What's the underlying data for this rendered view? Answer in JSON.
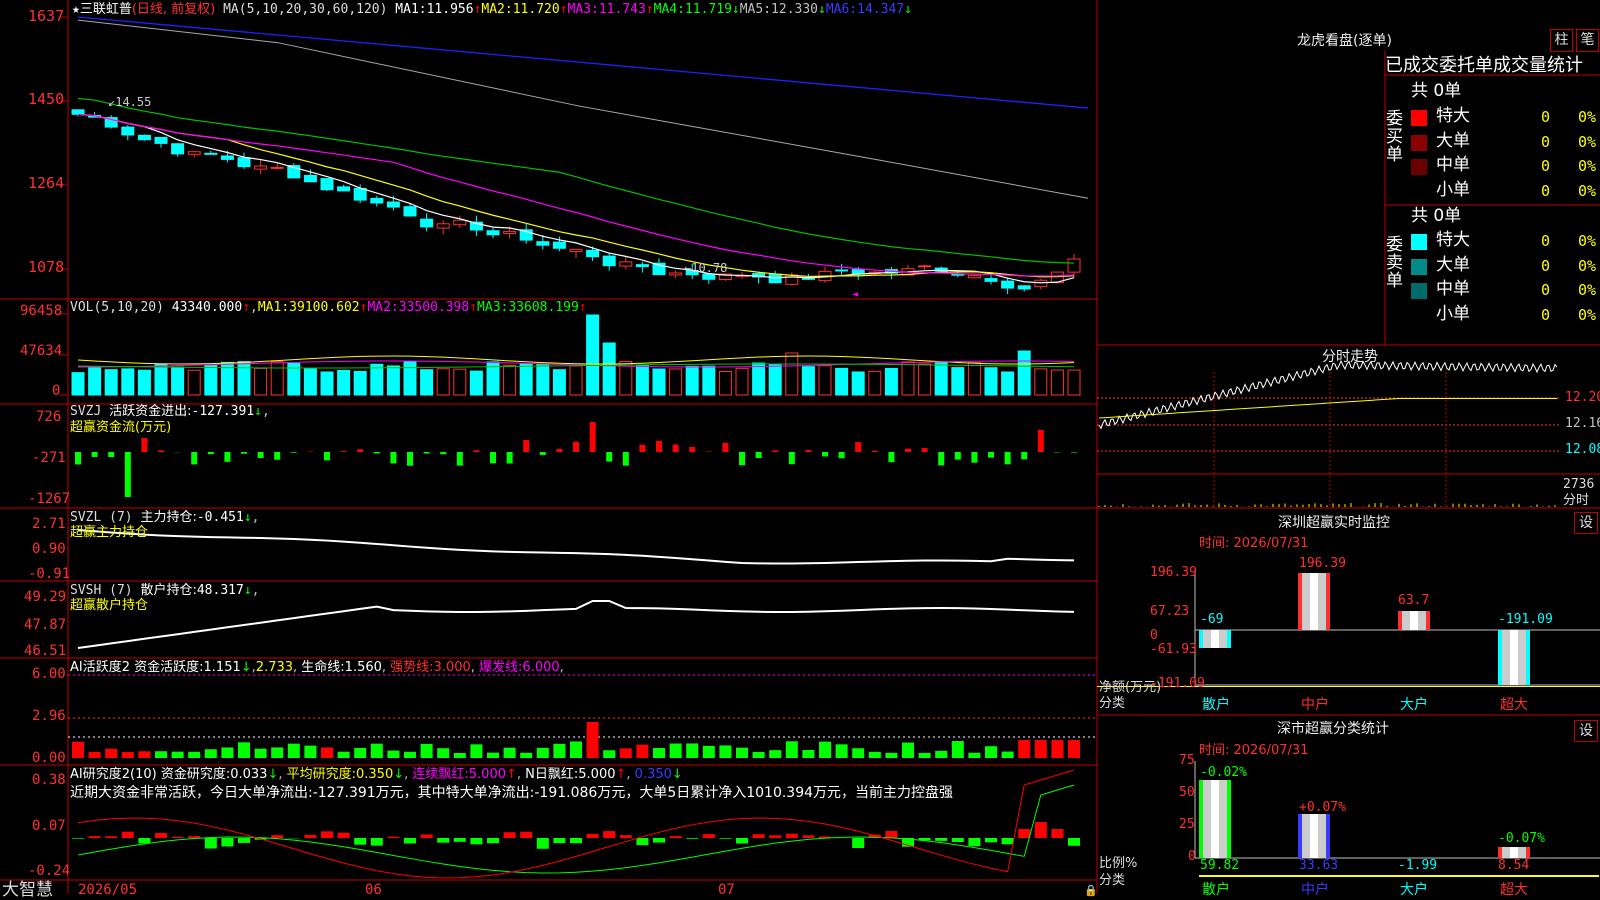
{
  "stock_name": "三联虹普",
  "period_label": "(日线, 前复权)",
  "ma_formula": "MA(5,10,20,30,60,120)",
  "ma": [
    {
      "label": "MA1:",
      "value": "11.956",
      "arrow": "↑",
      "color": "#ffffff"
    },
    {
      "label": "MA2:",
      "value": "11.720",
      "arrow": "↑",
      "color": "#ffff00"
    },
    {
      "label": "MA3:",
      "value": "11.743",
      "arrow": "↑",
      "color": "#ff00ff"
    },
    {
      "label": "MA4:",
      "value": "11.719",
      "arrow": "↓",
      "color": "#00ff00"
    },
    {
      "label": "MA5:",
      "value": "12.330",
      "arrow": "↓",
      "color": "#c0c0c0"
    },
    {
      "label": "MA6:",
      "value": "14.347",
      "arrow": "↓",
      "color": "#3b3bff"
    }
  ],
  "price_axis": [
    "1637",
    "1450",
    "1264",
    "1078"
  ],
  "price_high_label": "14.55",
  "price_low_label": "10.78",
  "vol": {
    "formula": "VOL(5,10,20)",
    "value": "43340.000",
    "arrow": "↑",
    "ma": [
      {
        "label": "MA1:",
        "value": "39100.602",
        "arrow": "↑",
        "color": "#ffff00"
      },
      {
        "label": "MA2:",
        "value": "33500.398",
        "arrow": "↑",
        "color": "#ff00ff"
      },
      {
        "label": "MA3:",
        "value": "33608.199",
        "arrow": "↑",
        "color": "#00ff00"
      }
    ],
    "axis": [
      "96458",
      "47634",
      "0"
    ]
  },
  "svzj": {
    "formula": "SVZJ",
    "label": "活跃资金进出:",
    "value": "-127.391",
    "arrow": "↓",
    "subtitle": "超赢资金流(万元)",
    "axis": [
      "726",
      "-271",
      "-1267"
    ]
  },
  "svzl": {
    "formula": "SVZL (7)",
    "label": "主力持仓:",
    "value": "-0.451",
    "arrow": "↓",
    "subtitle": "超赢主力持仓",
    "axis": [
      "2.71",
      "0.90",
      "-0.91"
    ]
  },
  "svsh": {
    "formula": "SVSH (7)",
    "label": "散户持仓:",
    "value": "48.317",
    "arrow": "↓",
    "subtitle": "超赢散户持仓",
    "axis": [
      "49.29",
      "47.87",
      "46.51"
    ]
  },
  "ai_active": {
    "formula": "AI活跃度2",
    "label": "资金活跃度:",
    "value": "1.151",
    "arrow": "↓",
    "value2": "2.733",
    "life_label": "生命线:",
    "life_value": "1.560",
    "strong_label": "强势线:",
    "strong_value": "3.000",
    "burst_label": "爆发线:",
    "burst_value": "6.000",
    "axis": [
      "6.00",
      "2.96",
      "0.00"
    ]
  },
  "ai_research": {
    "formula": "AI研究度2(10)",
    "label": "资金研究度:",
    "value": "0.033",
    "arrow": "↓",
    "avg_label": "平均研究度:",
    "avg_value": "0.350",
    "avg_arrow": "↓",
    "cont_label": "连续飘红:",
    "cont_value": "5.000",
    "cont_arrow": "↑",
    "n_label": "N日飘红:",
    "n_value": "5.000",
    "n_arrow": "↑",
    "last_value": "0.350",
    "last_arrow": "↓",
    "comment": "近期大资金非常活跃，今日大单净流出:-127.391万元，其中特大单净流出:-191.086万元，大单5日累计净入1010.394万元，当前主力控盘强",
    "axis": [
      "0.38",
      "0.07",
      "-0.24"
    ]
  },
  "date_axis": [
    "2026/05",
    "06",
    "07"
  ],
  "brand": "大智慧",
  "right": {
    "dragon_title": "龙虎看盘(逐单)",
    "btn_bar": "柱",
    "btn_pen": "笔",
    "stat_title": "已成交委托单成交量统计",
    "buy_label": "委买单",
    "sell_label": "委卖单",
    "buy_total": "共 0单",
    "sell_total": "共 0单",
    "buy_rows": [
      {
        "name": "特大",
        "count": "0",
        "pct": "0%",
        "color": "#ff0000"
      },
      {
        "name": "大单",
        "count": "0",
        "pct": "0%",
        "color": "#8b0000"
      },
      {
        "name": "中单",
        "count": "0",
        "pct": "0%",
        "color": "#6b0000"
      },
      {
        "name": "小单",
        "count": "0",
        "pct": "0%",
        "color": ""
      }
    ],
    "sell_rows": [
      {
        "name": "特大",
        "count": "0",
        "pct": "0%",
        "color": "#00ffff"
      },
      {
        "name": "大单",
        "count": "0",
        "pct": "0%",
        "color": "#008b8b"
      },
      {
        "name": "中单",
        "count": "0",
        "pct": "0%",
        "color": "#006b6b"
      },
      {
        "name": "小单",
        "count": "0",
        "pct": "0%",
        "color": ""
      }
    ],
    "intraday_title": "分时走势",
    "intraday_axis": [
      "12.20",
      "12.16",
      "12.08"
    ],
    "intraday_vol": [
      "2736",
      "分时"
    ],
    "sz_monitor_title": "深圳超赢实时监控",
    "btn_set": "设",
    "time_label": "时间: 2026/07/31",
    "monitor_axis": [
      "196.39",
      "67.23",
      "0",
      "-61.93",
      "-191.09"
    ],
    "monitor_bars": [
      {
        "cat": "散户",
        "value": "-69"
      },
      {
        "cat": "中户",
        "value": "196.39"
      },
      {
        "cat": "大户",
        "value": "63.7"
      },
      {
        "cat": "超大",
        "value": "-191.09"
      }
    ],
    "monitor_ylabel": "净额(万元)",
    "monitor_xlabel": "分类",
    "class_title": "深市超赢分类统计",
    "class_axis": [
      "75",
      "50",
      "25",
      "0"
    ],
    "class_bars": [
      {
        "cat": "散户",
        "top": "-0.02%",
        "bottom": "59.82"
      },
      {
        "cat": "中户",
        "top": "+0.07%",
        "bottom": "33.63"
      },
      {
        "cat": "大户",
        "top": "",
        "bottom": "-1.99"
      },
      {
        "cat": "超大",
        "top": "-0.07%",
        "bottom": "8.54"
      }
    ],
    "class_ylabel": "比例%",
    "class_xlabel": "分类"
  }
}
